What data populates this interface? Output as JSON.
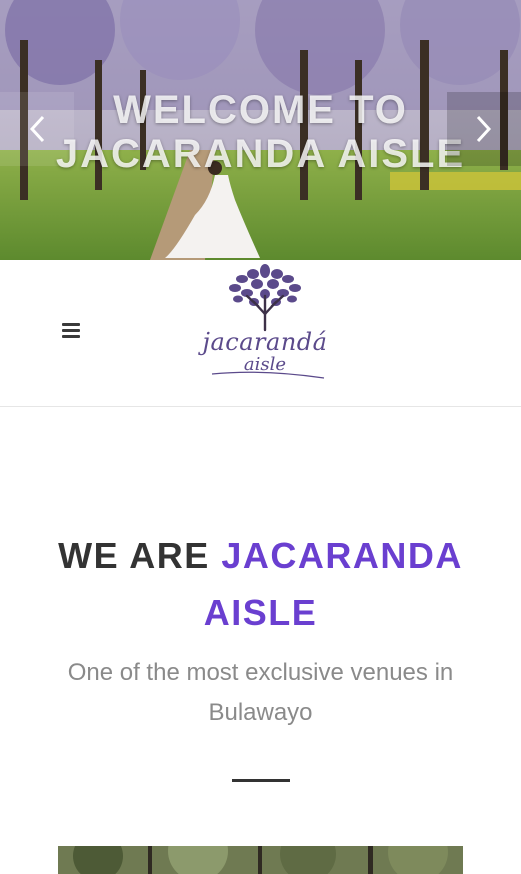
{
  "hero": {
    "title_line1": "WELCOME TO",
    "title_line2": "JACARANDA AISLE",
    "prev_icon": "chevron-left-icon",
    "next_icon": "chevron-right-icon"
  },
  "header": {
    "menu_icon": "hamburger-menu-icon",
    "logo_line1": "jacarandá",
    "logo_line2": "aisle"
  },
  "intro": {
    "heading_prefix": "WE ARE",
    "heading_accent": "JACARANDA AISLE",
    "subtitle": "One of the most exclusive venues in Bulawayo"
  },
  "colors": {
    "accent": "#6a3fd0",
    "heading": "#333333",
    "subtitle": "#8a8a8a",
    "logo": "#5b4a8b"
  }
}
